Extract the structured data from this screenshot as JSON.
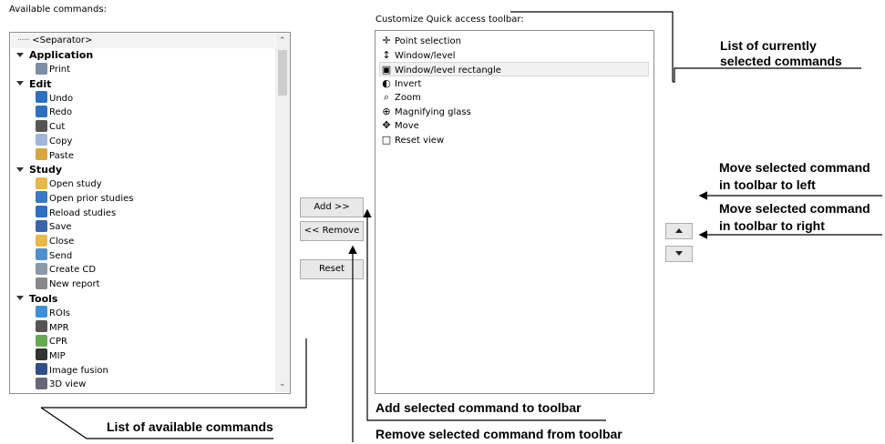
{
  "left_panel": {
    "title": "Available commands:",
    "separator": "<Separator>",
    "groups": [
      {
        "label": "Application",
        "items": [
          "Print"
        ]
      },
      {
        "label": "Edit",
        "items": [
          "Undo",
          "Redo",
          "Cut",
          "Copy",
          "Paste"
        ]
      },
      {
        "label": "Study",
        "items": [
          "Open study",
          "Open prior studies",
          "Reload studies",
          "Save",
          "Close",
          "Send",
          "Create CD",
          "New report"
        ]
      },
      {
        "label": "Tools",
        "items": [
          "ROIs",
          "MPR",
          "CPR",
          "MIP",
          "Image fusion",
          "3D view"
        ]
      }
    ]
  },
  "right_panel": {
    "title": "Customize Quick access toolbar:",
    "items": [
      "Point selection",
      "Window/level",
      "Window/level rectangle",
      "Invert",
      "Zoom",
      "Magnifying glass",
      "Move",
      "Reset view"
    ],
    "selected_item": "Window/level rectangle"
  },
  "buttons": {
    "add": "Add >>",
    "remove": "<< Remove",
    "reset": "Reset"
  },
  "callouts": {
    "current_list_1": "List of currently",
    "current_list_2": "selected commands",
    "move_left_1": "Move selected command",
    "move_left_2": "in toolbar to left",
    "move_right_1": "Move selected command",
    "move_right_2": "in toolbar to right",
    "add_cmd": "Add selected command to toolbar",
    "remove_cmd": "Remove selected command from toolbar",
    "available_list": "List of available commands"
  },
  "colors": {
    "accent_blue": "#2f6fc0",
    "selected_bg": "#f1f1f1"
  }
}
